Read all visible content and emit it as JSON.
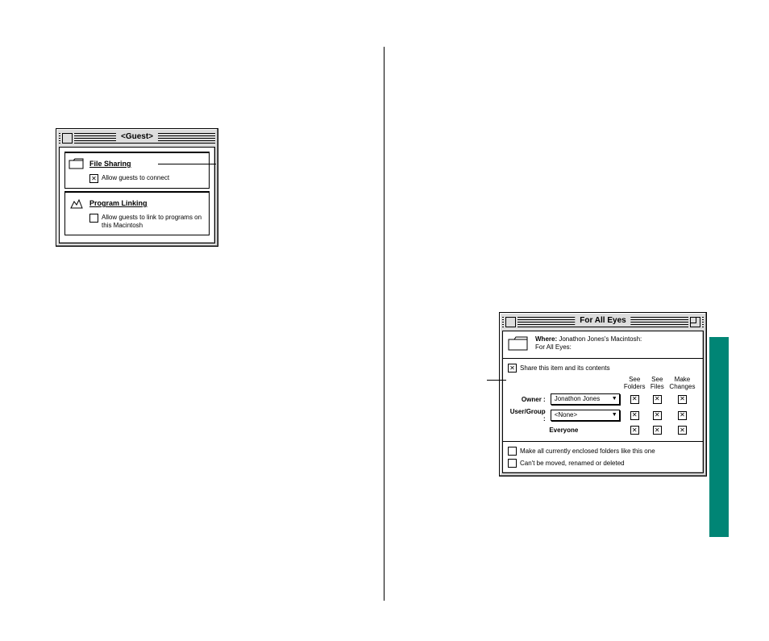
{
  "guest_window": {
    "title": "<Guest>",
    "file_sharing": {
      "label": "File Sharing",
      "allow_guests_label": "Allow guests to connect",
      "allow_guests_checked": true
    },
    "program_linking": {
      "label": "Program Linking",
      "allow_linking_label": "Allow guests to link to programs on this Macintosh",
      "allow_linking_checked": false
    }
  },
  "share_window": {
    "title": "For All Eyes",
    "where_label": "Where:",
    "where_value_line1": "Jonathon Jones's Macintosh:",
    "where_value_line2": "For All Eyes:",
    "share_item_label": "Share this item and its contents",
    "share_item_checked": true,
    "columns": {
      "see_folders": "See Folders",
      "see_files": "See Files",
      "make_changes": "Make Changes"
    },
    "rows": {
      "owner": {
        "role_label": "Owner :",
        "popup_value": "Jonathon Jones",
        "see_folders": true,
        "see_files": true,
        "make_changes": true
      },
      "user_group": {
        "role_label": "User/Group :",
        "popup_value": "<None>",
        "see_folders": true,
        "see_files": true,
        "make_changes": true
      },
      "everyone": {
        "role_label": "Everyone",
        "see_folders": true,
        "see_files": true,
        "make_changes": true
      }
    },
    "make_enclosed_label": "Make all currently enclosed folders like this one",
    "make_enclosed_checked": false,
    "locked_label": "Can't be moved, renamed or deleted",
    "locked_checked": false
  },
  "icons": {
    "folder": "folder-icon",
    "program_linking": "program-linking-icon",
    "close": "close-box-icon",
    "zoom": "zoom-box-icon",
    "popup_triangle": "▼"
  },
  "colors": {
    "accent_tab": "#008575",
    "window_face": "#dddddd"
  }
}
